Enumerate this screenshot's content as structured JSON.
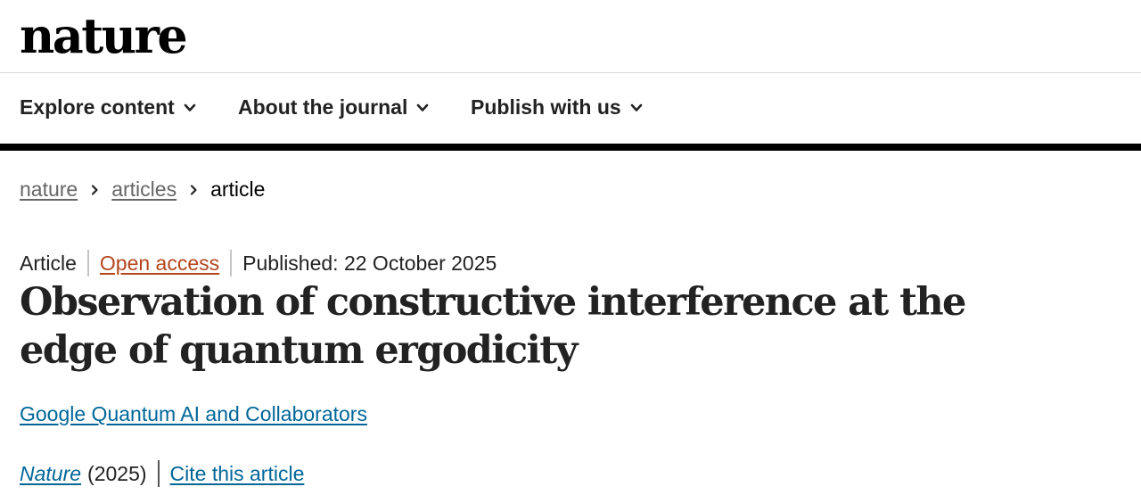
{
  "site": {
    "logo": "nature"
  },
  "nav": {
    "items": [
      {
        "label": "Explore content",
        "icon": "chevron-down-icon"
      },
      {
        "label": "About the journal",
        "icon": "chevron-down-icon"
      },
      {
        "label": "Publish with us",
        "icon": "chevron-down-icon"
      }
    ]
  },
  "breadcrumb": {
    "items": [
      {
        "label": "nature",
        "link": true
      },
      {
        "label": "articles",
        "link": true
      },
      {
        "label": "article",
        "link": false
      }
    ],
    "separator_icon": "chevron-right-icon"
  },
  "article": {
    "type": "Article",
    "access": "Open access",
    "published": "Published: 22 October 2025",
    "title": "Observation of constructive interference at the edge of quantum ergodicity",
    "authors": "Google Quantum AI and Collaborators",
    "journal": "Nature",
    "year": "(2025)",
    "cite_label": "Cite this article"
  },
  "colors": {
    "open_access": "#b3461d",
    "link": "#006699",
    "nav_rule": "#000000"
  }
}
